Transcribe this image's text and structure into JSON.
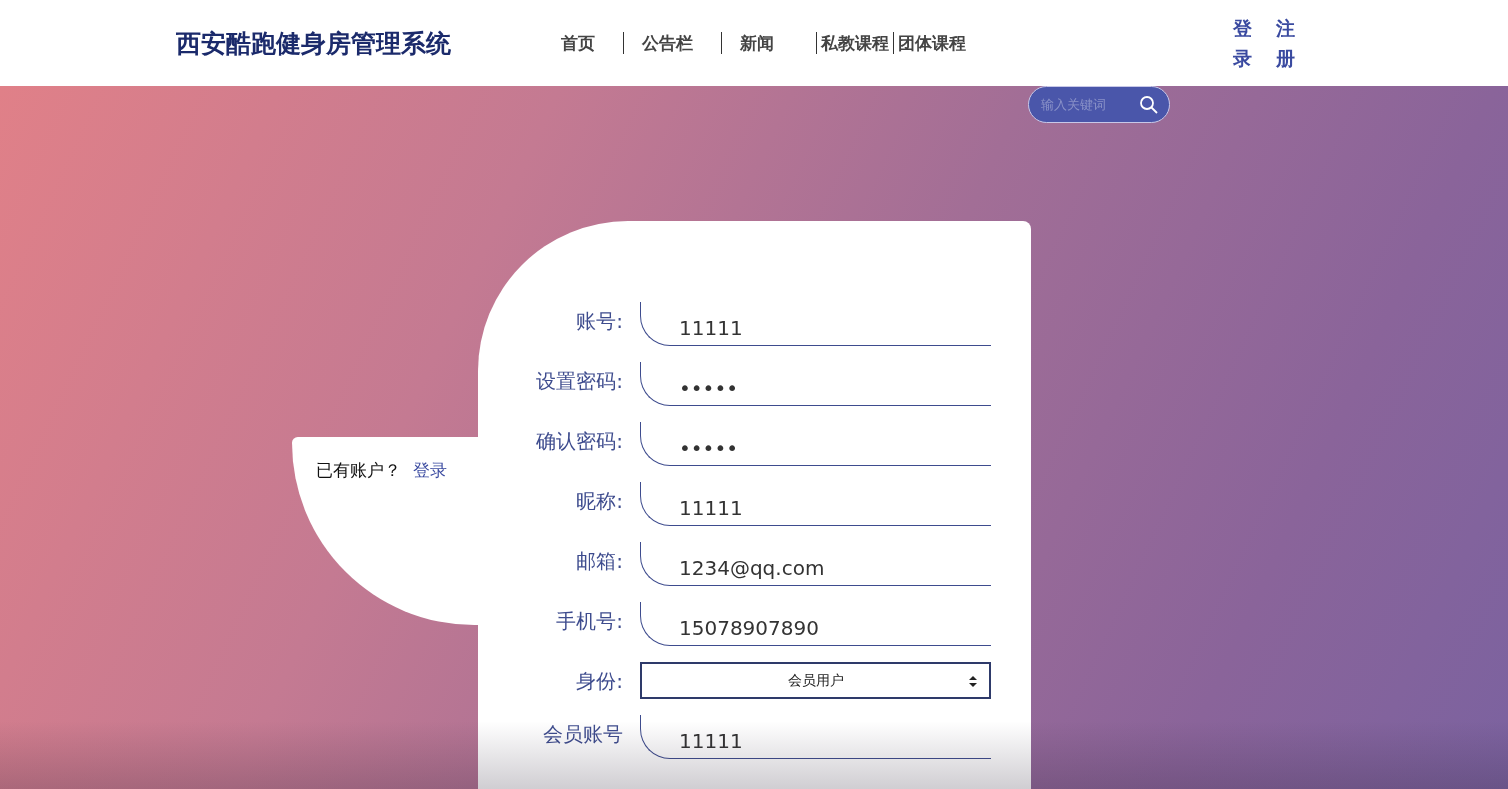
{
  "header": {
    "logo": "西安酷跑健身房管理系统",
    "nav": [
      {
        "label": "首页",
        "selected": false
      },
      {
        "label": "公告栏",
        "selected": false
      },
      {
        "label": "新闻",
        "selected": false
      },
      {
        "label": "私教课程",
        "selected": false
      },
      {
        "label": "团体课程",
        "selected": false
      }
    ],
    "auth_links": [
      "登录",
      "注册"
    ]
  },
  "search": {
    "placeholder": "输入关键词"
  },
  "side_panel": {
    "text": "已有账户？",
    "link": "登录"
  },
  "form": {
    "fields": [
      {
        "kind": "text",
        "label": "账号:",
        "value": "11111"
      },
      {
        "kind": "text",
        "label": "设置密码:",
        "value": "•••••"
      },
      {
        "kind": "text",
        "label": "确认密码:",
        "value": "•••••"
      },
      {
        "kind": "text",
        "label": "昵称:",
        "value": "11111"
      },
      {
        "kind": "text",
        "label": "邮箱:",
        "value": "1234@qq.com"
      },
      {
        "kind": "text",
        "label": "手机号:",
        "value": "15078907890"
      },
      {
        "kind": "select",
        "label": "身份:",
        "value": "会员用户"
      },
      {
        "kind": "text",
        "label": "会员账号",
        "value": "11111"
      }
    ]
  }
}
